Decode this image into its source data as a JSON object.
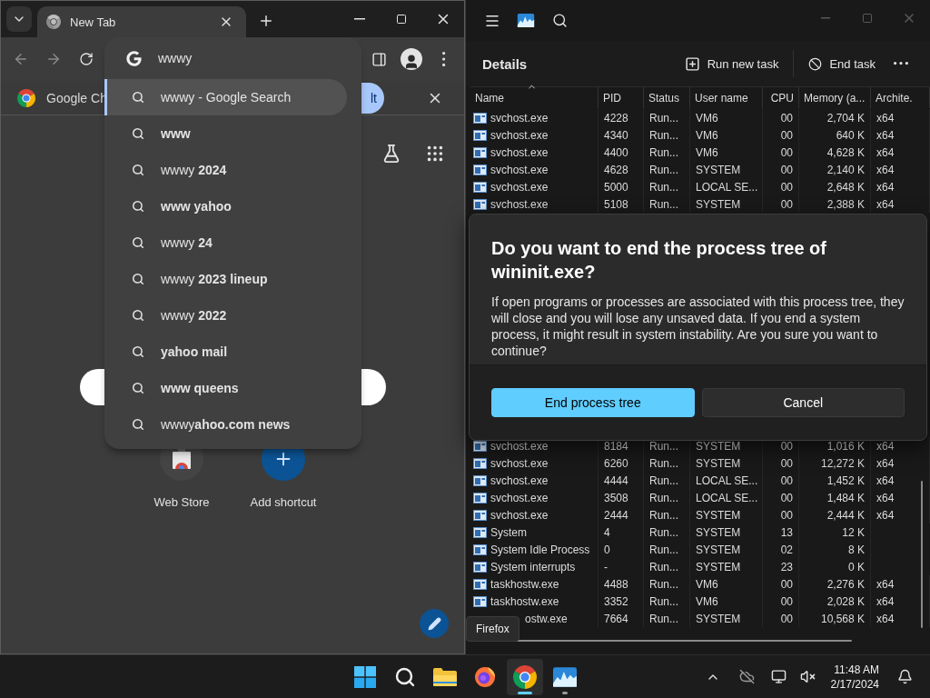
{
  "browser": {
    "tab": {
      "title": "New Tab"
    },
    "omnibox": {
      "value": "wwwy"
    },
    "suggestions": [
      {
        "text": "wwwy - Google Search",
        "bold": false,
        "selected": true
      },
      {
        "text": "www",
        "bold": true,
        "selected": false
      },
      {
        "text": "wwwy **2024**",
        "bold": false,
        "selected": false
      },
      {
        "text": "www yahoo",
        "bold": true,
        "selected": false
      },
      {
        "text": "wwwy **24**",
        "bold": false,
        "selected": false
      },
      {
        "text": "wwwy **2023 lineup**",
        "bold": false,
        "selected": false
      },
      {
        "text": "wwwy **2022**",
        "bold": false,
        "selected": false
      },
      {
        "text": "yahoo mail",
        "bold": true,
        "selected": false
      },
      {
        "text": "www queens",
        "bold": true,
        "selected": false
      },
      {
        "text": "wwwy**ahoo.com news**",
        "bold": false,
        "selected": false
      }
    ],
    "infobar": {
      "text": "Google Ch",
      "button": "lt"
    },
    "shortcuts": [
      {
        "label": "Web Store",
        "kind": "store"
      },
      {
        "label": "Add shortcut",
        "kind": "add"
      }
    ]
  },
  "task_manager": {
    "page_title": "Details",
    "actions": [
      "Run new task",
      "End task"
    ],
    "columns": [
      "Name",
      "PID",
      "Status",
      "User name",
      "CPU",
      "Memory (a...",
      "Archite."
    ],
    "rows_top": [
      {
        "icon": true,
        "cells": [
          "svchost.exe",
          "4228",
          "Run...",
          "VM6",
          "00",
          "2,704 K",
          "x64"
        ]
      },
      {
        "icon": true,
        "cells": [
          "svchost.exe",
          "4340",
          "Run...",
          "VM6",
          "00",
          "640 K",
          "x64"
        ]
      },
      {
        "icon": true,
        "cells": [
          "svchost.exe",
          "4400",
          "Run...",
          "VM6",
          "00",
          "4,628 K",
          "x64"
        ]
      },
      {
        "icon": true,
        "cells": [
          "svchost.exe",
          "4628",
          "Run...",
          "SYSTEM",
          "00",
          "2,140 K",
          "x64"
        ]
      },
      {
        "icon": true,
        "cells": [
          "svchost.exe",
          "5000",
          "Run...",
          "LOCAL SE...",
          "00",
          "2,648 K",
          "x64"
        ]
      },
      {
        "icon": true,
        "cells": [
          "svchost.exe",
          "5108",
          "Run...",
          "SYSTEM",
          "00",
          "2,388 K",
          "x64"
        ]
      }
    ],
    "rows_bottom": [
      {
        "icon": true,
        "cells": [
          "svchost.exe",
          "8184",
          "Run...",
          "SYSTEM",
          "00",
          "1,016 K",
          "x64"
        ]
      },
      {
        "icon": true,
        "cells": [
          "svchost.exe",
          "6260",
          "Run...",
          "SYSTEM",
          "00",
          "12,272 K",
          "x64"
        ]
      },
      {
        "icon": true,
        "cells": [
          "svchost.exe",
          "4444",
          "Run...",
          "LOCAL SE...",
          "00",
          "1,452 K",
          "x64"
        ]
      },
      {
        "icon": true,
        "cells": [
          "svchost.exe",
          "3508",
          "Run...",
          "LOCAL SE...",
          "00",
          "1,484 K",
          "x64"
        ]
      },
      {
        "icon": true,
        "cells": [
          "svchost.exe",
          "2444",
          "Run...",
          "SYSTEM",
          "00",
          "2,444 K",
          "x64"
        ]
      },
      {
        "icon": true,
        "cells": [
          "System",
          "4",
          "Run...",
          "SYSTEM",
          "13",
          "12 K"
        ]
      },
      {
        "icon": true,
        "cells": [
          "System Idle Process",
          "0",
          "Run...",
          "SYSTEM",
          "02",
          "8 K"
        ]
      },
      {
        "icon": true,
        "cells": [
          "System interrupts",
          "-",
          "Run...",
          "SYSTEM",
          "23",
          "0 K"
        ]
      },
      {
        "icon": true,
        "cells": [
          "taskhostw.exe",
          "4488",
          "Run...",
          "VM6",
          "00",
          "2,276 K",
          "x64"
        ]
      },
      {
        "icon": true,
        "cells": [
          "taskhostw.exe",
          "3352",
          "Run...",
          "VM6",
          "00",
          "2,028 K",
          "x64"
        ]
      },
      {
        "icon": false,
        "cells": [
          "ostw.exe",
          "7664",
          "Run...",
          "SYSTEM",
          "00",
          "10,568 K",
          "x64"
        ]
      }
    ]
  },
  "dialog": {
    "title": "Do you want to end the process tree of wininit.exe?",
    "body": "If open programs or processes are associated with this process tree, they will close and you will lose any unsaved data. If you end a system process, it might result in system instability. Are you sure you want to continue?",
    "buttons": [
      {
        "label": "End process tree",
        "kind": "primary"
      },
      {
        "label": "Cancel",
        "kind": "secondary"
      }
    ]
  },
  "tooltip": "Firefox",
  "taskbar": {
    "apps": [
      {
        "kind": "start",
        "active": false,
        "running": false
      },
      {
        "kind": "search",
        "active": false,
        "running": false
      },
      {
        "kind": "explorer",
        "active": false,
        "running": false
      },
      {
        "kind": "firefox",
        "active": false,
        "running": false
      },
      {
        "kind": "chrome",
        "active": true,
        "running": true
      },
      {
        "kind": "taskmgr",
        "active": false,
        "running": true
      }
    ],
    "time": "11:48 AM",
    "date": "2/17/2024"
  }
}
